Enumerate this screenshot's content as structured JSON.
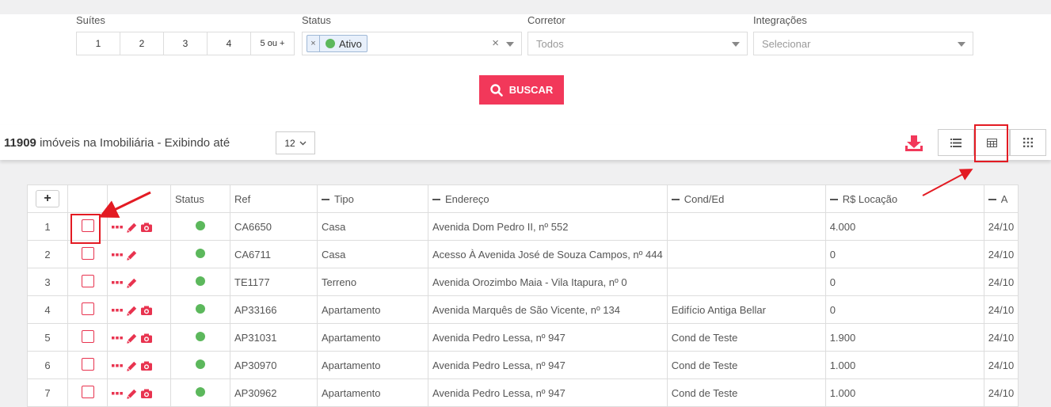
{
  "filters": {
    "suites": {
      "label": "Suítes",
      "options": [
        "1",
        "2",
        "3",
        "4",
        "5 ou +"
      ]
    },
    "status": {
      "label": "Status",
      "selected_tag": "Ativo",
      "remove_tag": "×",
      "clear": "×"
    },
    "corretor": {
      "label": "Corretor",
      "placeholder": "Todos"
    },
    "integracoes": {
      "label": "Integrações",
      "placeholder": "Selecionar"
    },
    "search_button": "BUSCAR"
  },
  "results": {
    "count": "11909",
    "count_text": "imóveis na Imobiliária - Exibindo até",
    "per_page": "12",
    "view_modes": [
      "list-view-icon",
      "table-view-icon",
      "grid-view-icon"
    ]
  },
  "table": {
    "add_column": "+",
    "headers": {
      "num": "",
      "check": "",
      "actions": "",
      "status": "Status",
      "ref": "Ref",
      "tipo": "Tipo",
      "endereco": "Endereço",
      "cond": "Cond/Ed",
      "locacao": "R$ Locação",
      "next": "A"
    },
    "rows": [
      {
        "n": "1",
        "camera": true,
        "ref": "CA6650",
        "tipo": "Casa",
        "endereco": "Avenida Dom Pedro II, nº 552",
        "cond": "",
        "locacao": "4.000",
        "next": "24/10"
      },
      {
        "n": "2",
        "camera": false,
        "ref": "CA6711",
        "tipo": "Casa",
        "endereco": "Acesso À Avenida José de Souza Campos, nº 444",
        "cond": "",
        "locacao": "0",
        "next": "24/10"
      },
      {
        "n": "3",
        "camera": false,
        "ref": "TE1177",
        "tipo": "Terreno",
        "endereco": "Avenida Orozimbo Maia - Vila Itapura, nº 0",
        "cond": "",
        "locacao": "0",
        "next": "24/10"
      },
      {
        "n": "4",
        "camera": true,
        "ref": "AP33166",
        "tipo": "Apartamento",
        "endereco": "Avenida Marquês de São Vicente, nº 134",
        "cond": "Edifício Antiga Bellar",
        "locacao": "0",
        "next": "24/10"
      },
      {
        "n": "5",
        "camera": true,
        "ref": "AP31031",
        "tipo": "Apartamento",
        "endereco": "Avenida Pedro Lessa, nº 947",
        "cond": "Cond de Teste",
        "locacao": "1.900",
        "next": "24/10"
      },
      {
        "n": "6",
        "camera": true,
        "ref": "AP30970",
        "tipo": "Apartamento",
        "endereco": "Avenida Pedro Lessa, nº 947",
        "cond": "Cond de Teste",
        "locacao": "1.000",
        "next": "24/10"
      },
      {
        "n": "7",
        "camera": true,
        "ref": "AP30962",
        "tipo": "Apartamento",
        "endereco": "Avenida Pedro Lessa, nº 947",
        "cond": "Cond de Teste",
        "locacao": "1.000",
        "next": "24/10"
      }
    ]
  },
  "colors": {
    "accent": "#f2385a",
    "status_active": "#5cb85c",
    "annotation": "#e31b23"
  }
}
